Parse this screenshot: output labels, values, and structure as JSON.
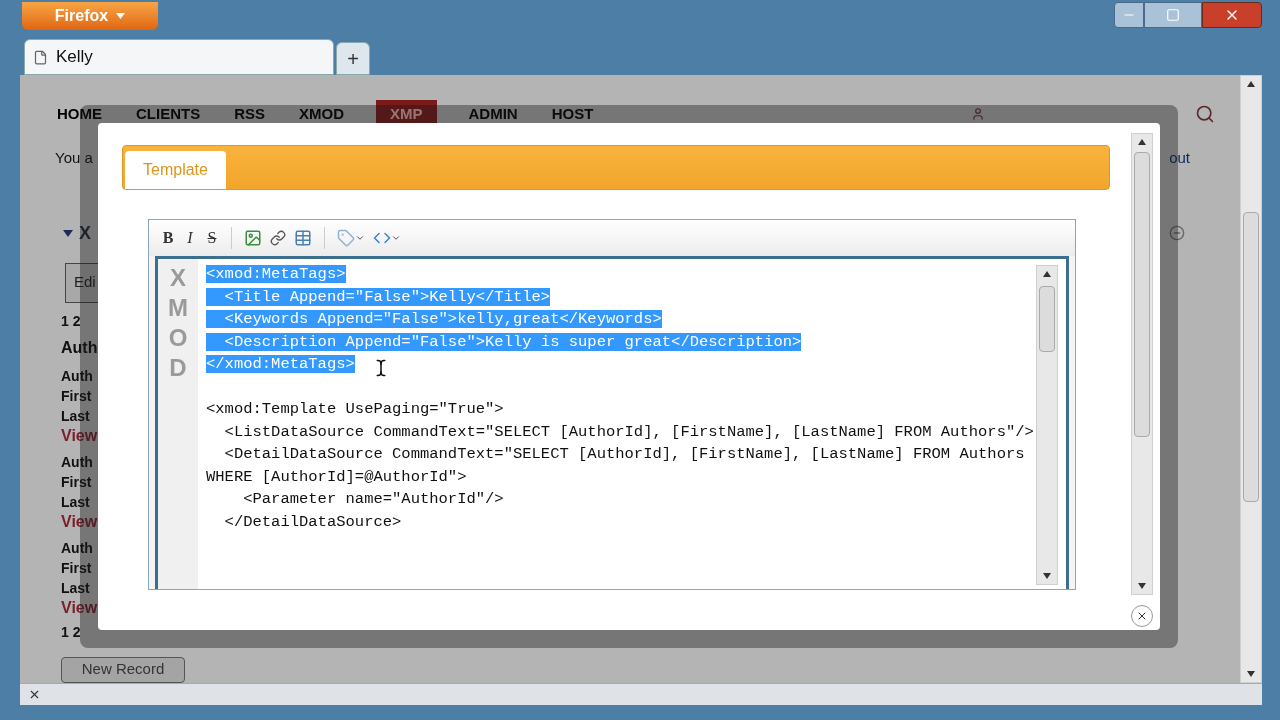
{
  "browser": {
    "app_button": "Firefox",
    "tab": {
      "title": "Kelly"
    },
    "new_tab": "+"
  },
  "page": {
    "nav": [
      {
        "label": "HOME",
        "selected": false
      },
      {
        "label": "CLIENTS",
        "selected": false
      },
      {
        "label": "RSS",
        "selected": false
      },
      {
        "label": "XMOD",
        "selected": false
      },
      {
        "label": "XMP",
        "selected": true
      },
      {
        "label": "ADMIN",
        "selected": false
      },
      {
        "label": "HOST",
        "selected": false
      }
    ],
    "greeting": "You a",
    "logout": "out",
    "section_title": "X",
    "edit_button": "Edi",
    "pager_top": "1 2",
    "list_heading": "Auth",
    "records": [
      {
        "lines": [
          "Auth",
          "First",
          "Last"
        ],
        "link": "View"
      },
      {
        "lines": [
          "Auth",
          "First",
          "Last"
        ],
        "link": "View"
      },
      {
        "lines": [
          "Auth",
          "First",
          "Last"
        ],
        "link": "View"
      }
    ],
    "pager_bottom": "1 2",
    "new_record_button": "New Record"
  },
  "modal": {
    "tabs": [
      {
        "label": "Template",
        "selected": true
      }
    ],
    "toolbar": [
      {
        "kind": "bold",
        "label": "B"
      },
      {
        "kind": "italic",
        "label": "I"
      },
      {
        "kind": "strike",
        "label": "S"
      },
      {
        "kind": "separator"
      },
      {
        "kind": "image"
      },
      {
        "kind": "link"
      },
      {
        "kind": "table"
      },
      {
        "kind": "separator"
      },
      {
        "kind": "tag"
      },
      {
        "kind": "code"
      }
    ],
    "gutter_letters": [
      "X",
      "M",
      "O",
      "D"
    ],
    "code_lines": [
      {
        "kind": "code",
        "text": "<xmod:MetaTags>",
        "selected": true
      },
      {
        "kind": "code",
        "text": "  <Title Append=\"False\">Kelly</Title>",
        "selected": true
      },
      {
        "kind": "code",
        "text": "  <Keywords Append=\"False\">kelly,great</Keywords>",
        "selected": true
      },
      {
        "kind": "code",
        "text": "  <Description Append=\"False\">Kelly is super great</Description>",
        "selected": true
      },
      {
        "kind": "code",
        "text": "</xmod:MetaTags>",
        "selected": true
      },
      {
        "kind": "blank"
      },
      {
        "kind": "code",
        "text": "<xmod:Template UsePaging=\"True\">",
        "selected": false
      },
      {
        "kind": "code",
        "text": "  <ListDataSource CommandText=\"SELECT [AuthorId], [FirstName], [LastName] FROM Authors\"/>",
        "selected": false
      },
      {
        "kind": "code",
        "text": "  <DetailDataSource CommandText=\"SELECT [AuthorId], [FirstName], [LastName] FROM Authors",
        "selected": false
      },
      {
        "kind": "code",
        "text": "WHERE [AuthorId]=@AuthorId\">",
        "selected": false
      },
      {
        "kind": "code",
        "text": "    <Parameter name=\"AuthorId\"/>",
        "selected": false
      },
      {
        "kind": "code",
        "text": "  </DetailDataSource>",
        "selected": false
      }
    ]
  }
}
